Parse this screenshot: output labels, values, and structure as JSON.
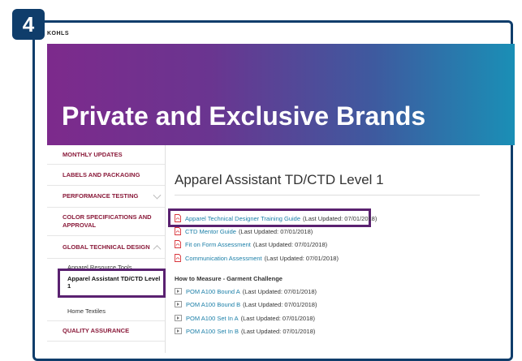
{
  "step_number": "4",
  "brand_logo_text": "KOHLS",
  "hero": {
    "title": "Private and Exclusive Brands"
  },
  "sidebar": {
    "items": [
      {
        "label": "MONTHLY UPDATES"
      },
      {
        "label": "LABELS AND PACKAGING"
      },
      {
        "label": "PERFORMANCE TESTING",
        "chevron": "chevron-down"
      },
      {
        "label": "COLOR SPECIFICATIONS AND APPROVAL"
      },
      {
        "label": "GLOBAL TECHNICAL DESIGN",
        "chevron": "chevron-up"
      },
      {
        "label": "QUALITY ASSURANCE"
      }
    ],
    "subitems": [
      {
        "label": "Apparel Resource Tools"
      },
      {
        "label": "Apparel Assistant TD/CTD Level 1",
        "active": true
      },
      {
        "label": "Home Textiles"
      }
    ]
  },
  "main": {
    "title": "Apparel Assistant TD/CTD Level 1",
    "documents": [
      {
        "link": "Apparel Technical Designer Training Guide",
        "updated": "(Last Updated: 07/01/2018)",
        "icon": "pdf-icon"
      },
      {
        "link": "CTD Mentor Guide",
        "updated": "(Last Updated: 07/01/2018)",
        "icon": "pdf-icon"
      },
      {
        "link": "Fit on Form Assessment",
        "updated": "(Last Updated: 07/01/2018)",
        "icon": "pdf-icon"
      },
      {
        "link": "Communication Assessment",
        "updated": "(Last Updated: 07/01/2018)",
        "icon": "pdf-icon"
      }
    ],
    "section_heading": "How to Measure - Garment Challenge",
    "videos": [
      {
        "link": "POM A100 Bound A",
        "updated": "(Last Updated: 07/01/2018)",
        "icon": "video-icon"
      },
      {
        "link": "POM A100 Bound B",
        "updated": "(Last Updated: 07/01/2018)",
        "icon": "video-icon"
      },
      {
        "link": "POM A100 Set In A",
        "updated": "(Last Updated: 07/01/2018)",
        "icon": "video-icon"
      },
      {
        "link": "POM A100 Set In B",
        "updated": "(Last Updated: 07/01/2018)",
        "icon": "video-icon"
      }
    ]
  },
  "colors": {
    "badge": "#0f3d6b",
    "highlight": "#5a2170",
    "sidebar_text": "#8a1a3a",
    "link": "#1b7fa8",
    "pdf_icon": "#d9343a"
  }
}
